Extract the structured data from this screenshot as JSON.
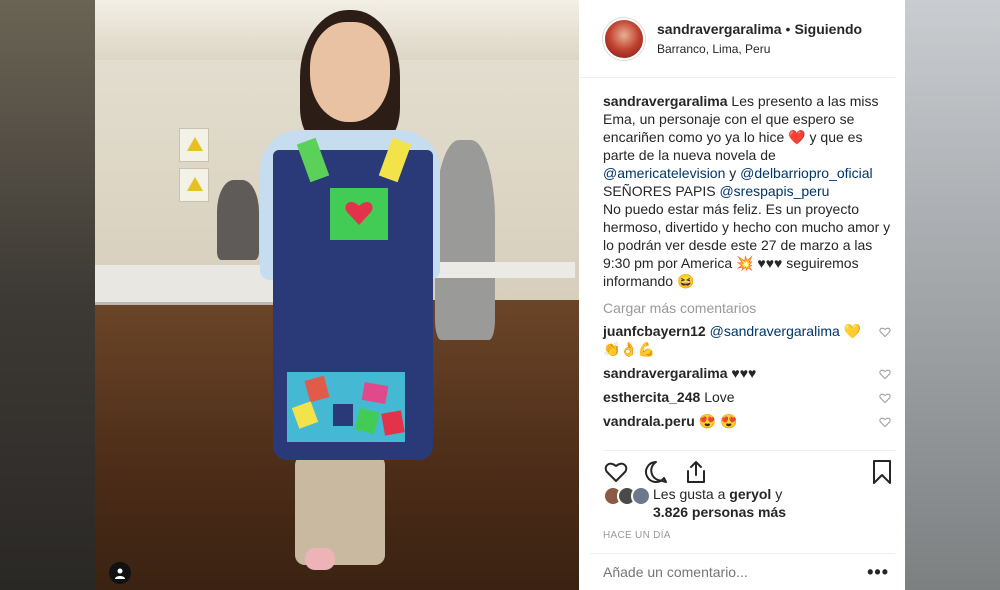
{
  "header": {
    "username": "sandravergaralima",
    "separator": "•",
    "follow_status": "Siguiendo",
    "location": "Barranco, Lima, Peru"
  },
  "caption": {
    "username": "sandravergaralima",
    "text_1": "Les presento a las miss Ema, un personaje con el que espero se encariñen como yo ya lo hice",
    "heart_emoji": "❤️",
    "text_2": "y que es parte de la nueva novela de",
    "mention_1": "@americatelevision",
    "text_3": "y",
    "mention_2": "@delbarriopro_oficial",
    "text_4": "SEÑORES PAPIS",
    "mention_3": "@srespapis_peru",
    "text_5": "No puedo estar más feliz. Es un proyecto hermoso, divertido y hecho con mucho amor y lo podrán ver desde este 27 de marzo a las 9:30 pm por America",
    "sparkle_emoji": "💥",
    "text_6": "♥♥♥ seguiremos informando",
    "smile_emoji": "😆"
  },
  "load_more": "Cargar más comentarios",
  "comments": [
    {
      "username": "juanfcbayern12",
      "mention": "@sandravergaralima",
      "text": "💛",
      "extra": "👏👌💪"
    },
    {
      "username": "sandravergaralima",
      "text": "♥♥♥"
    },
    {
      "username": "esthercita_248",
      "text": "Love"
    },
    {
      "username": "vandrala.peru",
      "text": "😍 😍"
    }
  ],
  "likes": {
    "prefix": "Les gusta a",
    "user": "geryol",
    "connector": "y",
    "count": "3.826 personas más"
  },
  "time_ago": "HACE UN DÍA",
  "add_comment": {
    "placeholder": "Añade un comentario...",
    "more": "•••"
  },
  "icons": {
    "like": "heart-icon",
    "comment": "comment-icon",
    "share": "share-icon",
    "save": "bookmark-icon",
    "user_tag": "user-icon"
  },
  "colors": {
    "link": "#003569",
    "muted": "#999999",
    "text": "#262626"
  }
}
